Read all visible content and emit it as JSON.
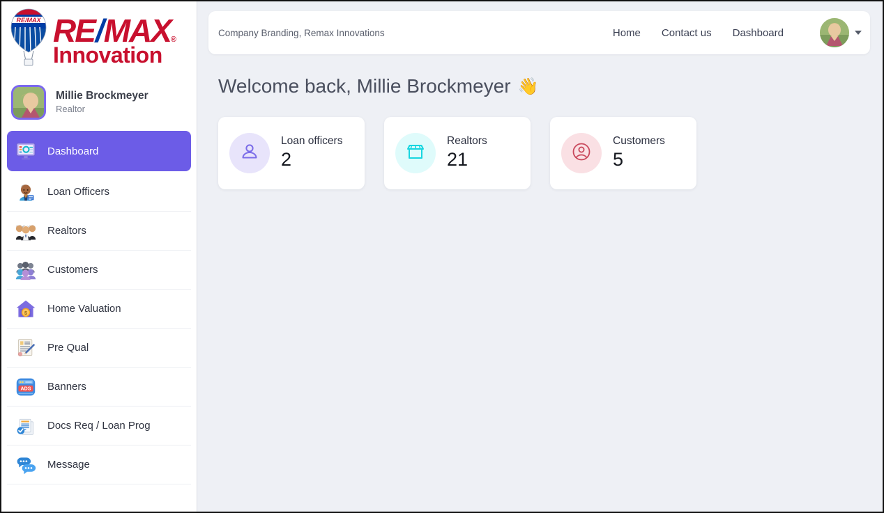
{
  "brand": {
    "logo_name": "remax-logo",
    "remax_re": "RE",
    "remax_slash": "/",
    "remax_max": "MAX",
    "registered_mark": "®",
    "subtitle": "Innovation"
  },
  "profile": {
    "name": "Millie Brockmeyer",
    "role": "Realtor",
    "avatar_name": "sidebar-avatar"
  },
  "sidebar": {
    "items": [
      {
        "label": "Dashboard",
        "icon": "dashboard-monitor-icon",
        "emoji": "🖥️",
        "active": true
      },
      {
        "label": "Loan Officers",
        "icon": "office-worker-icon",
        "emoji": "👨‍💼",
        "active": false
      },
      {
        "label": "Realtors",
        "icon": "people-group-icon",
        "emoji": "👔",
        "active": false
      },
      {
        "label": "Customers",
        "icon": "busts-silhouette-icon",
        "emoji": "👥",
        "active": false
      },
      {
        "label": "Home Valuation",
        "icon": "house-with-money-icon",
        "emoji": "🏠",
        "active": false
      },
      {
        "label": "Pre Qual",
        "icon": "document-signing-icon",
        "emoji": "📝",
        "active": false
      },
      {
        "label": "Banners",
        "icon": "ads-banner-icon",
        "emoji": "📰",
        "active": false
      },
      {
        "label": "Docs Req / Loan Prog",
        "icon": "checked-documents-icon",
        "emoji": "📋",
        "active": false
      },
      {
        "label": "Message",
        "icon": "speech-bubbles-icon",
        "emoji": "💬",
        "active": false
      }
    ]
  },
  "topbar": {
    "company_branding": "Company Branding, Remax Innovations",
    "links": [
      {
        "label": "Home"
      },
      {
        "label": "Contact us"
      },
      {
        "label": "Dashboard"
      }
    ],
    "avatar_name": "topbar-avatar",
    "caret_name": "chevron-down-icon"
  },
  "main": {
    "welcome_text": "Welcome back, Millie Brockmeyer",
    "welcome_emoji": "👋",
    "cards": [
      {
        "label": "Loan officers",
        "value": "2",
        "icon": "person-icon",
        "icon_color": "#7b6de8",
        "bg_color": "#e8e4fb"
      },
      {
        "label": "Realtors",
        "value": "21",
        "icon": "storefront-icon",
        "icon_color": "#18d6e0",
        "bg_color": "#dffbfb"
      },
      {
        "label": "Customers",
        "value": "5",
        "icon": "user-circle-icon",
        "icon_color": "#c9485c",
        "bg_color": "#fae0e4"
      }
    ]
  },
  "colors": {
    "accent": "#6c5ce7",
    "page_bg": "#eef0f5",
    "card_bg": "#ffffff",
    "brand_red": "#c8102e",
    "brand_blue": "#003da5"
  }
}
